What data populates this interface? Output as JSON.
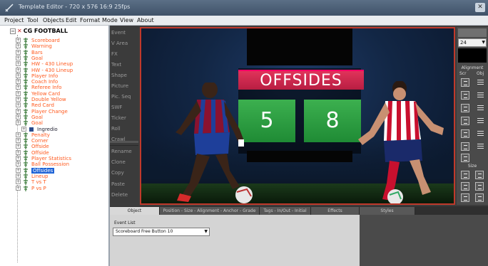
{
  "window": {
    "title": "Template Editor - 720 x 576 16:9 25fps"
  },
  "menu": [
    "Project",
    "Tool",
    "Objects",
    "Edit",
    "Format",
    "Mode",
    "View",
    "About"
  ],
  "tree": {
    "root": "CG FOOTBALL",
    "items": [
      "Scoreboard",
      "Warning",
      "Bars",
      "Goal",
      "HW - 430 Lineup",
      "HW - 430 Lineup",
      "Player Info",
      "Coach Info",
      "Referee Info",
      "Yellow Card",
      "Double Yellow",
      "Red Card",
      "Player Change",
      "Goal",
      "Goal",
      "Ingredio",
      "Penalty",
      "Corner",
      "Offside",
      "Offside",
      "Player Statistics",
      "Ball Possession",
      "Offsides",
      "Lineup",
      "T vs T",
      "P vs P"
    ],
    "selected": "Offsides"
  },
  "toolbar": [
    "Event",
    "V Area",
    "FX",
    "Text",
    "Shape",
    "Picture",
    "Pic. Seq",
    "SWF",
    "Ticker",
    "Roll",
    "Crawl",
    "Rename",
    "Clone",
    "Copy",
    "Paste",
    "Delete"
  ],
  "canvas": {
    "banner": "OFFSIDES",
    "score_left": "5",
    "score_right": "8"
  },
  "right_panel": {
    "font_size": "24",
    "alignment_header": "Alignment",
    "scr_label": "Scr",
    "obj_label": "Obj",
    "size_label": "Size"
  },
  "bottom_tabs": [
    "Object",
    "Position - Size - Alignment - Anchor - Grade",
    "Tags - In/Out - Initial",
    "Effects",
    "Styles"
  ],
  "event_list": {
    "label": "Event List",
    "value": "Scoreboard Free Button 10"
  },
  "colors": {
    "banner": "#d4264e",
    "score_box": "#2e9e44",
    "selection": "#1e63d6",
    "tree_text": "#ff5a1f"
  }
}
